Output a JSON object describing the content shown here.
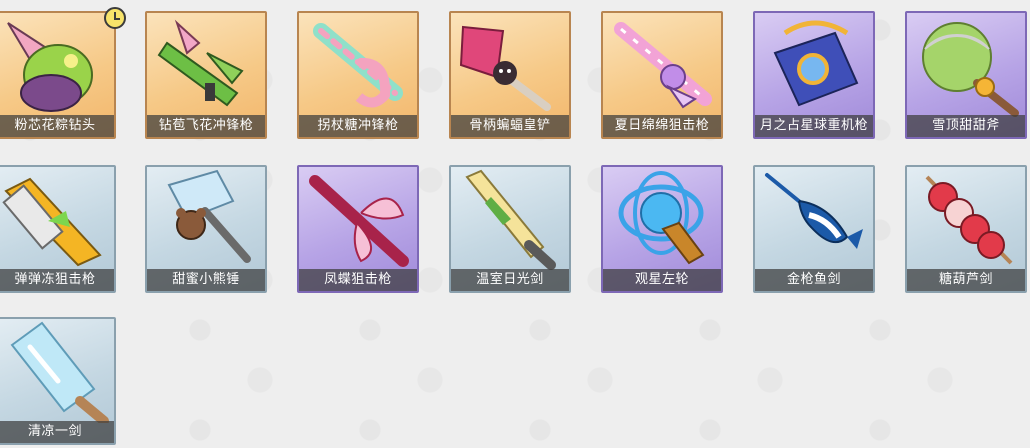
{
  "items": [
    {
      "name": "粉芯花粽钻头",
      "rarity": "orange",
      "icon": "drill-weapon-icon",
      "accent": "#b9e14f",
      "accent2": "#7b4a8b"
    },
    {
      "name": "钻苞飞花冲锋枪",
      "rarity": "orange",
      "icon": "smg-weapon-icon",
      "accent": "#74c64a",
      "accent2": "#f3a7c7"
    },
    {
      "name": "拐杖糖冲锋枪",
      "rarity": "orange",
      "icon": "candy-cane-gun-icon",
      "accent": "#f4a3bf",
      "accent2": "#8fe0c9"
    },
    {
      "name": "骨柄蝙蝠皇铲",
      "rarity": "orange",
      "icon": "bat-shovel-icon",
      "accent": "#e0477a",
      "accent2": "#3a2c33"
    },
    {
      "name": "夏日绵绵狙击枪",
      "rarity": "orange",
      "icon": "sniper-rifle-icon",
      "accent": "#f2a3d6",
      "accent2": "#c18de8"
    },
    {
      "name": "月之占星球重机枪",
      "rarity": "purple",
      "icon": "heavy-machine-gun-icon",
      "accent": "#3f4fb8",
      "accent2": "#f1b437"
    },
    {
      "name": "雪顶甜甜斧",
      "rarity": "purple",
      "icon": "ice-cream-axe-icon",
      "accent": "#a5d46a",
      "accent2": "#f5b536"
    },
    {
      "name": "弹弹冻狙击枪",
      "rarity": "blue",
      "icon": "jelly-sniper-icon",
      "accent": "#f4b524",
      "accent2": "#6a6a6a"
    },
    {
      "name": "甜蜜小熊锤",
      "rarity": "blue",
      "icon": "bear-hammer-icon",
      "accent": "#9ad0f0",
      "accent2": "#8a5a3a"
    },
    {
      "name": "凤蝶狙击枪",
      "rarity": "purple",
      "icon": "butterfly-sniper-icon",
      "accent": "#a8234a",
      "accent2": "#f6c0d6"
    },
    {
      "name": "温室日光剑",
      "rarity": "blue",
      "icon": "greenhouse-sword-icon",
      "accent": "#f5e39a",
      "accent2": "#5fae45"
    },
    {
      "name": "观星左轮",
      "rarity": "purple",
      "icon": "stargazer-revolver-icon",
      "accent": "#3aa3e8",
      "accent2": "#c9862a"
    },
    {
      "name": "金枪鱼剑",
      "rarity": "blue",
      "icon": "tuna-sword-icon",
      "accent": "#1c5aa8",
      "accent2": "#ffffff"
    },
    {
      "name": "糖葫芦剑",
      "rarity": "blue",
      "icon": "candied-haws-sword-icon",
      "accent": "#e23a4a",
      "accent2": "#f7d3d3"
    },
    {
      "name": "清凉一剑",
      "rarity": "blue",
      "icon": "popsicle-sword-icon",
      "accent": "#bfe8f7",
      "accent2": "#b58456"
    }
  ]
}
